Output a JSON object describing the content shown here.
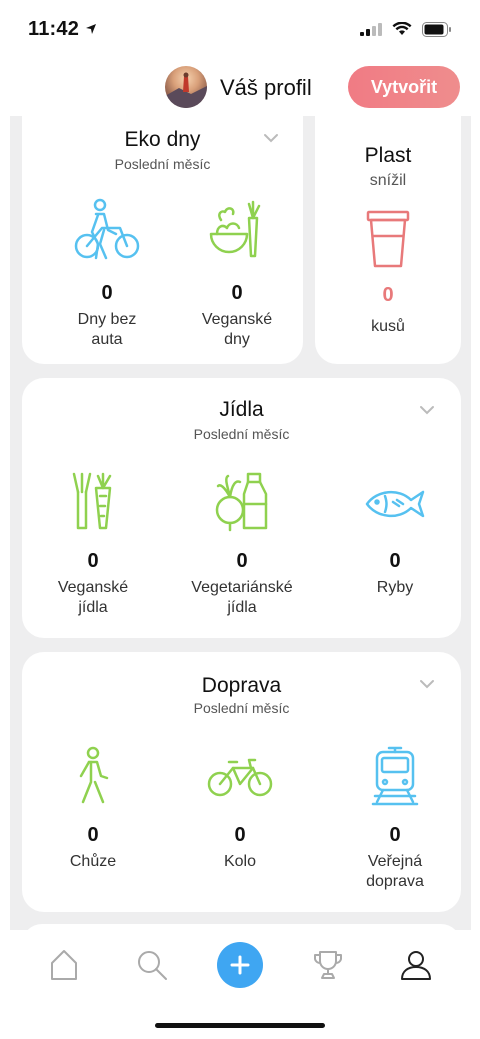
{
  "status": {
    "time": "11:42"
  },
  "header": {
    "profile_label": "Váš profil",
    "create_label": "Vytvořit"
  },
  "eko": {
    "title": "Eko dny",
    "subtitle": "Poslední měsíc",
    "stats": [
      {
        "icon": "bike-pushing-icon",
        "value": "0",
        "label": "Dny bez\nauta"
      },
      {
        "icon": "salad-carrot-icon",
        "value": "0",
        "label": "Veganské\ndny"
      }
    ]
  },
  "plast": {
    "title": "Plast",
    "subtitle": "snížil",
    "value": "0",
    "unit": "kusů",
    "icon": "cup-icon"
  },
  "jidla": {
    "title": "Jídla",
    "subtitle": "Poslední měsíc",
    "stats": [
      {
        "icon": "leek-carrot-icon",
        "value": "0",
        "label": "Veganské\njídla"
      },
      {
        "icon": "beet-milk-icon",
        "value": "0",
        "label": "Vegetariánské\njídla"
      },
      {
        "icon": "fish-icon",
        "value": "0",
        "label": "Ryby"
      }
    ]
  },
  "doprava": {
    "title": "Doprava",
    "subtitle": "Poslední měsíc",
    "stats": [
      {
        "icon": "walking-icon",
        "value": "0",
        "label": "Chůze"
      },
      {
        "icon": "bicycle-icon",
        "value": "0",
        "label": "Kolo"
      },
      {
        "icon": "train-icon",
        "value": "0",
        "label": "Veřejná\ndoprava"
      }
    ]
  },
  "colors": {
    "accent": "#3fa6f2",
    "create": "#ef7f88",
    "green": "#8fd14f",
    "blue": "#56c1f0",
    "red": "#e8797a"
  },
  "tabs": [
    "home-icon",
    "search-icon",
    "plus-icon",
    "trophy-icon",
    "profile-icon"
  ]
}
